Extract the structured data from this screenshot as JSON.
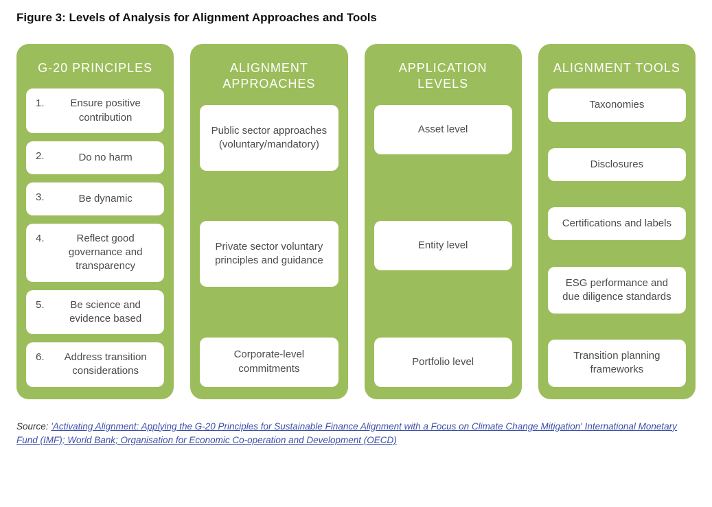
{
  "figure_title": "Figure 3: Levels of Analysis for Alignment Approaches and Tools",
  "columns": {
    "principles": {
      "header": "G-20 PRINCIPLES",
      "items": [
        {
          "n": "1.",
          "label": "Ensure positive contribution"
        },
        {
          "n": "2.",
          "label": "Do no harm"
        },
        {
          "n": "3.",
          "label": "Be dynamic"
        },
        {
          "n": "4.",
          "label": "Reflect good governance and transparency"
        },
        {
          "n": "5.",
          "label": "Be science and evidence based"
        },
        {
          "n": "6.",
          "label": "Address transition considerations"
        }
      ]
    },
    "approaches": {
      "header": "ALIGNMENT APPROACHES",
      "items": [
        "Public sector approaches (voluntary/mandatory)",
        "Private sector voluntary principles and guidance",
        "Corporate-level commitments"
      ]
    },
    "levels": {
      "header": "APPLICATION LEVELS",
      "items": [
        "Asset level",
        "Entity level",
        "Portfolio level"
      ]
    },
    "tools": {
      "header": "ALIGNMENT TOOLS",
      "items": [
        "Taxonomies",
        "Disclosures",
        "Certifications and labels",
        "ESG performance and due diligence standards",
        "Transition planning frameworks"
      ]
    }
  },
  "source": {
    "lead": "Source: ",
    "link_text": "'Activating Alignment: Applying the G-20 Principles for Sustainable Finance Alignment with a Focus on Climate Change Mitigation' International Monetary Fund (IMF); World Bank; Organisation for Economic Co-operation and Development (OECD)"
  }
}
